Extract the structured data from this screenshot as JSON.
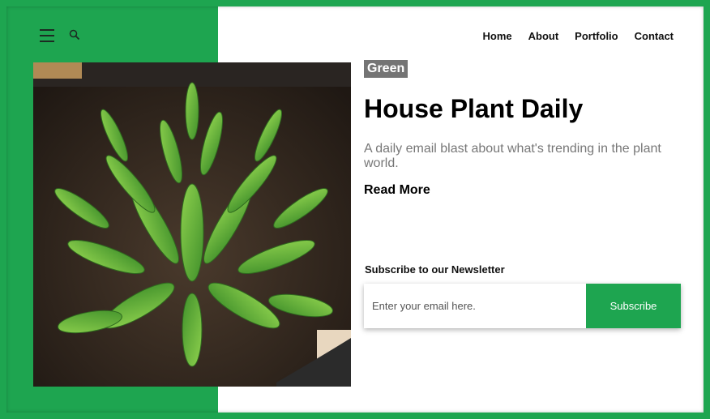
{
  "nav": {
    "items": [
      {
        "label": "Home"
      },
      {
        "label": "About"
      },
      {
        "label": "Portfolio"
      },
      {
        "label": "Contact"
      }
    ]
  },
  "hero": {
    "tag": "Green",
    "title": "House Plant Daily",
    "description": "A daily email blast about what's trending in the plant world.",
    "cta": "Read More"
  },
  "newsletter": {
    "label": "Subscribe to our Newsletter",
    "placeholder": "Enter your email here.",
    "value": "",
    "button": "Subscribe"
  },
  "colors": {
    "accent": "#1ea550",
    "tag_bg": "#747474"
  },
  "icons": {
    "menu": "hamburger-menu-icon",
    "search": "search-icon"
  }
}
